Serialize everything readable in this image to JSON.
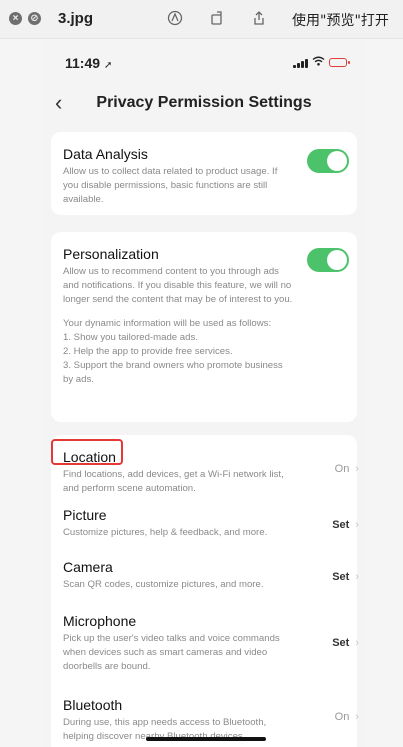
{
  "viewer": {
    "filename": "3.jpg",
    "open_with_label": "使用\"预览\"打开",
    "close_symbol": "×",
    "minimize_symbol": "⊘",
    "icons": [
      "markup-icon",
      "rotate-icon",
      "share-icon"
    ]
  },
  "phone": {
    "time": "11:49",
    "battery_color": "#e23d3d"
  },
  "nav": {
    "title": "Privacy Permission Settings",
    "back_symbol": "‹"
  },
  "toggles": [
    {
      "title": "Data Analysis",
      "description": "Allow us to collect data related to product usage. If you disable permissions, basic functions are still available.",
      "enabled": true
    },
    {
      "title": "Personalization",
      "description": "Allow us to recommend content to you through ads and notifications. If you disable this feature, we will no longer send the content that may be of interest to you.",
      "extra_intro": "Your dynamic information will be used as follows:",
      "extra_items": [
        "1. Show you tailored-made ads.",
        "2. Help the app to provide free services.",
        "3. Support the brand owners who promote business by ads."
      ],
      "enabled": true
    }
  ],
  "permissions": [
    {
      "title": "Location",
      "description": "Find locations, add devices, get a Wi-Fi network list, and perform scene automation.",
      "value": "On",
      "highlighted": true
    },
    {
      "title": "Picture",
      "description": "Customize pictures, help & feedback, and more.",
      "value": "Set"
    },
    {
      "title": "Camera",
      "description": "Scan QR codes, customize pictures, and more.",
      "value": "Set"
    },
    {
      "title": "Microphone",
      "description": "Pick up the user's video talks and voice commands when devices such as smart cameras and video doorbells are bound.",
      "value": "Set"
    },
    {
      "title": "Bluetooth",
      "description": "During use, this app needs access to Bluetooth, helping discover nearby Bluetooth devices.",
      "value": "On"
    }
  ],
  "colors": {
    "toggle_on": "#4cc36a",
    "highlight_border": "#e53935"
  }
}
